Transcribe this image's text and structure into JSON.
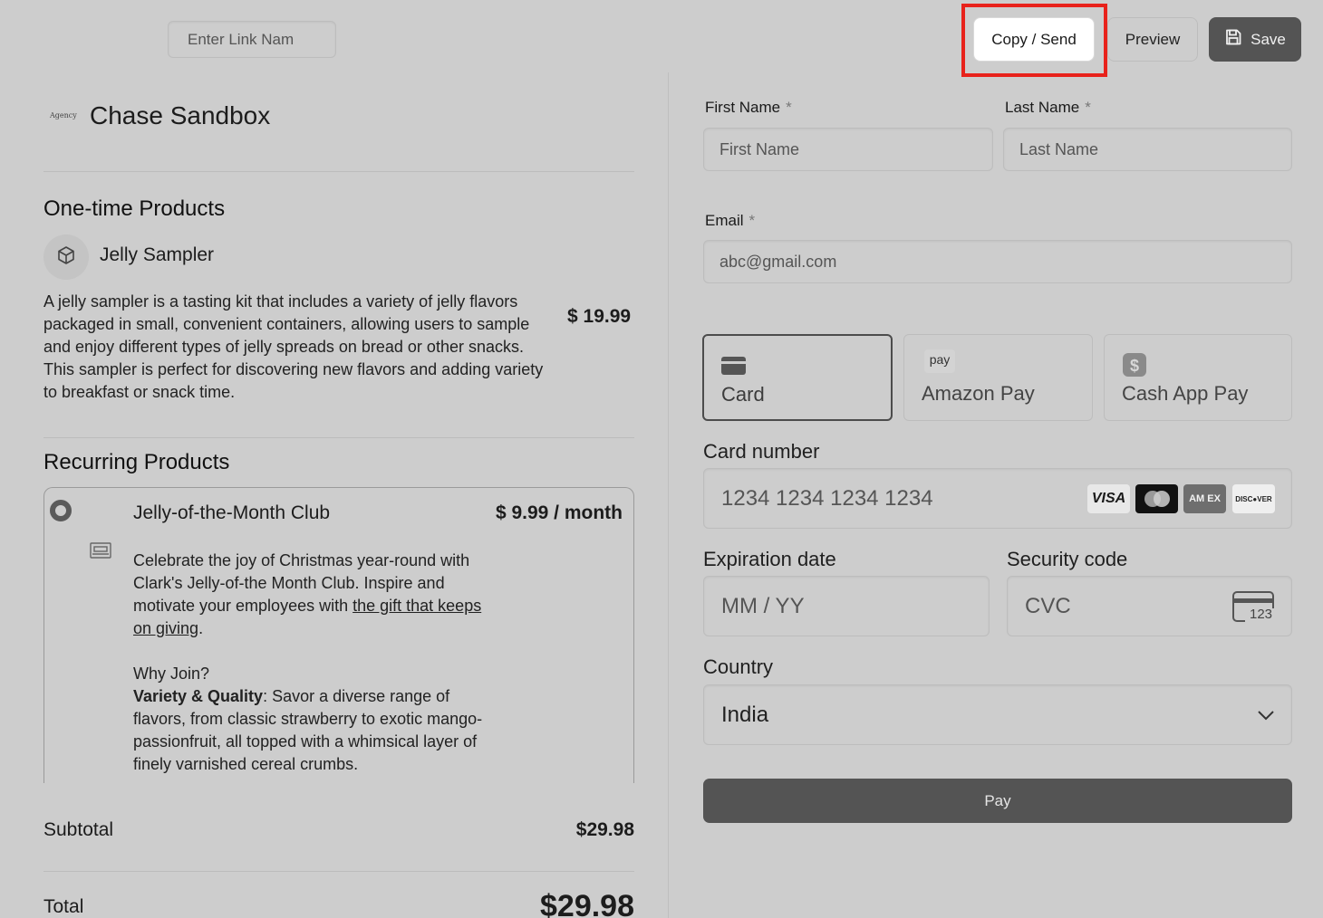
{
  "topbar": {
    "link_name_placeholder": "Enter Link Nam",
    "copy_send_label": "Copy / Send",
    "preview_label": "Preview",
    "save_label": "Save",
    "highlight_color": "#e8221b"
  },
  "store": {
    "logo_text": "Agency",
    "name": "Chase Sandbox"
  },
  "one_time": {
    "title": "One-time Products",
    "product": {
      "icon": "box-icon",
      "name": "Jelly Sampler",
      "description": "A jelly sampler is a tasting kit that includes a variety of jelly flavors packaged in small, convenient containers, allowing users to sample and enjoy different types of jelly spreads on bread or other snacks. This sampler is perfect for discovering new flavors and adding variety to breakfast or snack time.",
      "price": "$ 19.99"
    }
  },
  "recurring": {
    "title": "Recurring Products",
    "product": {
      "name": "Jelly-of-the-Month Club",
      "price": "$ 9.99 / month",
      "desc_intro": "Celebrate the joy of Christmas year-round with Clark's Jelly-of-the Month Club. Inspire and motivate your employees with ",
      "desc_link": "the gift that keeps on giving",
      "desc_end": ".",
      "why_join": "Why Join?",
      "variety_bold": "Variety & Quality",
      "variety_text": ": Savor a diverse range of flavors, from classic strawberry to exotic mango-passionfruit, all topped with a whimsical layer of finely varnished cereal crumbs."
    }
  },
  "summary": {
    "subtotal_label": "Subtotal",
    "subtotal_value": "$29.98",
    "total_label": "Total",
    "total_value": "$29.98"
  },
  "form": {
    "first_name_label": "First Name",
    "first_name_placeholder": "First Name",
    "last_name_label": "Last Name",
    "last_name_placeholder": "Last Name",
    "email_label": "Email",
    "email_placeholder": "abc@gmail.com",
    "required_mark": "*",
    "payment_methods": [
      {
        "label": "Card",
        "icon": "credit-card-icon",
        "selected": true
      },
      {
        "label": "Amazon Pay",
        "icon": "amazon-pay-icon",
        "icon_text": "pay",
        "selected": false
      },
      {
        "label": "Cash App Pay",
        "icon": "cash-app-icon",
        "selected": false
      }
    ],
    "card_number_label": "Card number",
    "card_number_placeholder": "1234 1234 1234 1234",
    "card_brands": [
      "VISA",
      "Mastercard",
      "AMEX",
      "DISCOVER"
    ],
    "amex_text": "AM EX",
    "discover_text": "DISC●VER",
    "expiration_label": "Expiration date",
    "expiration_placeholder": "MM / YY",
    "security_label": "Security code",
    "security_placeholder": "CVC",
    "cvc_icon_text": "123",
    "country_label": "Country",
    "country_value": "India",
    "pay_label": "Pay"
  }
}
